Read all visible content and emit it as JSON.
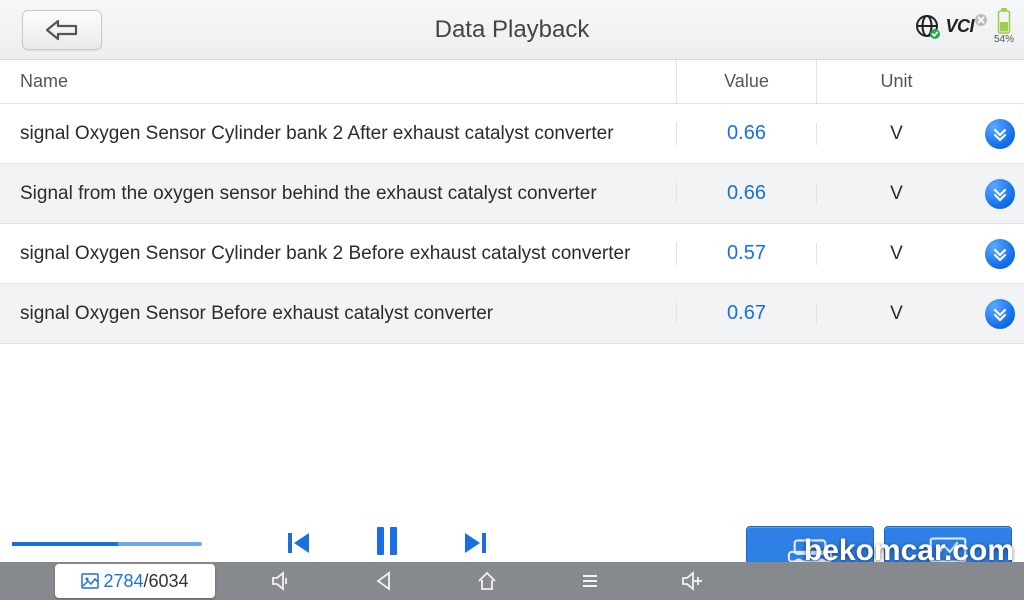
{
  "header": {
    "title": "Data Playback",
    "vci_label": "VCI",
    "battery_percent": "54%"
  },
  "columns": {
    "name": "Name",
    "value": "Value",
    "unit": "Unit"
  },
  "rows": [
    {
      "name": "signal Oxygen Sensor Cylinder bank 2 After exhaust catalyst converter",
      "value": "0.66",
      "unit": "V"
    },
    {
      "name": "Signal from the oxygen sensor behind the exhaust catalyst converter",
      "value": "0.66",
      "unit": "V"
    },
    {
      "name": "signal Oxygen Sensor Cylinder bank 2 Before exhaust catalyst converter",
      "value": "0.57",
      "unit": "V"
    },
    {
      "name": "signal Oxygen Sensor Before exhaust catalyst converter",
      "value": "0.67",
      "unit": "V"
    }
  ],
  "playback": {
    "current_frame": "2784",
    "separator": " / ",
    "total_frames": "6034"
  },
  "watermark": "bekomcar.com"
}
